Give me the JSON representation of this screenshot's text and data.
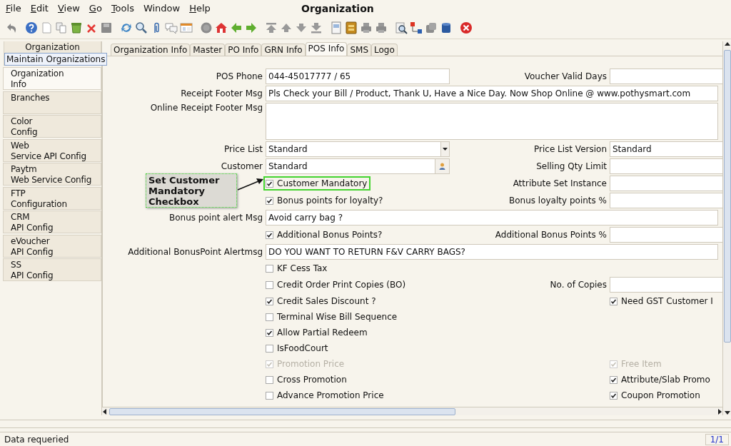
{
  "window": {
    "title": "Organization"
  },
  "menu": [
    {
      "label": "File",
      "underlined": true
    },
    {
      "label": "Edit",
      "underlined": true
    },
    {
      "label": "View",
      "underlined": true
    },
    {
      "label": "Go",
      "underlined": true
    },
    {
      "label": "Tools",
      "underlined": true
    },
    {
      "label": "Window",
      "underlined": false
    },
    {
      "label": "Help",
      "underlined": true
    }
  ],
  "sidebar": {
    "header": "Organization",
    "tooltip": "Maintain Organizations",
    "items": [
      {
        "label": "Organization\nInfo",
        "selected": true
      },
      {
        "label": "Branches",
        "selected": false
      },
      {
        "label": "Color\nConfig",
        "selected": false
      },
      {
        "label": "Web\nService API Config",
        "selected": false
      },
      {
        "label": "Paytm\nWeb Service Config",
        "selected": false
      },
      {
        "label": "FTP\nConfiguration",
        "selected": false
      },
      {
        "label": "CRM\nAPI Config",
        "selected": false
      },
      {
        "label": "eVoucher\nAPI Config",
        "selected": false
      },
      {
        "label": "SS\nAPI Config",
        "selected": false
      }
    ]
  },
  "tabs": [
    {
      "label": "Organization Info",
      "selected": false
    },
    {
      "label": "Master",
      "selected": false
    },
    {
      "label": "PO Info",
      "selected": false
    },
    {
      "label": "GRN Info",
      "selected": false
    },
    {
      "label": "POS Info",
      "selected": true
    },
    {
      "label": "SMS",
      "selected": false
    },
    {
      "label": "Logo",
      "selected": false
    }
  ],
  "form": {
    "rows": [
      {
        "left": {
          "kind": "text",
          "label": "POS Phone",
          "value": "044-45017777  / 65"
        },
        "right": {
          "kind": "field",
          "label": "Voucher Valid Days"
        }
      },
      {
        "left": {
          "kind": "wide",
          "label": "Receipt Footer Msg",
          "value": "Pls Check your Bill / Product, Thank U, Have a Nice Day. Now Shop Online @ www.pothysmart.com"
        }
      },
      {
        "left": {
          "kind": "textarea",
          "label": "Online Receipt Footer Msg"
        }
      },
      {
        "left": {
          "kind": "dropdown",
          "label": "Price List",
          "value": "Standard"
        },
        "right": {
          "kind": "field",
          "label": "Price List Version",
          "value": "Standard"
        }
      },
      {
        "left": {
          "kind": "lookup",
          "label": "Customer",
          "value": "Standard"
        },
        "right": {
          "kind": "field",
          "label": "Selling Qty Limit"
        }
      },
      {
        "left": {
          "kind": "checkbox",
          "label": "Customer Mandatory",
          "checked": true,
          "disabled": false,
          "highlighted": true
        },
        "right": {
          "kind": "field",
          "label": "Attribute Set Instance"
        }
      },
      {
        "left": {
          "kind": "checkbox",
          "label": "Bonus points for loyalty?",
          "checked": true,
          "disabled": false,
          "highlighted": false
        },
        "right": {
          "kind": "field",
          "label": "Bonus loyalty points %"
        }
      },
      {
        "left": {
          "kind": "wide",
          "label": "Bonus point alert Msg",
          "value": "Avoid carry bag ?"
        }
      },
      {
        "left": {
          "kind": "checkbox",
          "label": "Additional Bonus Points?",
          "checked": true,
          "disabled": false,
          "highlighted": false
        },
        "right": {
          "kind": "field",
          "label": "Additional Bonus Points %"
        }
      },
      {
        "left": {
          "kind": "wide",
          "label": "Additional BonusPoint Alertmsg",
          "value": "DO YOU WANT TO RETURN F&V CARRY BAGS?"
        }
      },
      {
        "left": {
          "kind": "checkbox",
          "label": "KF Cess Tax",
          "checked": false,
          "disabled": false,
          "highlighted": false
        }
      },
      {
        "left": {
          "kind": "checkbox",
          "label": "Credit Order Print Copies (BO)",
          "checked": false,
          "disabled": false,
          "highlighted": false
        },
        "right": {
          "kind": "field",
          "label": "No. of Copies"
        }
      },
      {
        "left": {
          "kind": "checkbox",
          "label": "Credit Sales Discount ?",
          "checked": true,
          "disabled": false,
          "highlighted": false
        },
        "right": {
          "kind": "checkbox",
          "label": "Need GST Customer I",
          "checked": true,
          "disabled": false
        }
      },
      {
        "left": {
          "kind": "checkbox",
          "label": "Terminal Wise Bill Sequence",
          "checked": false,
          "disabled": false,
          "highlighted": false
        }
      },
      {
        "left": {
          "kind": "checkbox",
          "label": "Allow Partial Redeem",
          "checked": true,
          "disabled": false,
          "highlighted": false
        }
      },
      {
        "left": {
          "kind": "checkbox",
          "label": "IsFoodCourt",
          "checked": false,
          "disabled": false,
          "highlighted": false
        }
      },
      {
        "left": {
          "kind": "checkbox",
          "label": "Promotion Price",
          "checked": true,
          "disabled": true,
          "highlighted": false
        },
        "right": {
          "kind": "checkbox",
          "label": "Free Item",
          "checked": true,
          "disabled": true
        }
      },
      {
        "left": {
          "kind": "checkbox",
          "label": "Cross Promotion",
          "checked": false,
          "disabled": false,
          "highlighted": false
        },
        "right": {
          "kind": "checkbox",
          "label": "Attribute/Slab Promo",
          "checked": true,
          "disabled": false
        }
      },
      {
        "left": {
          "kind": "checkbox",
          "label": "Advance Promotion Price",
          "checked": false,
          "disabled": false,
          "highlighted": false
        },
        "right": {
          "kind": "checkbox",
          "label": "Coupon Promotion",
          "checked": true,
          "disabled": false
        }
      }
    ]
  },
  "annotation": {
    "text": "Set Customer Mandatory Checkbox"
  },
  "status_bar": {
    "message": "Data requeried",
    "page": "1/1"
  }
}
